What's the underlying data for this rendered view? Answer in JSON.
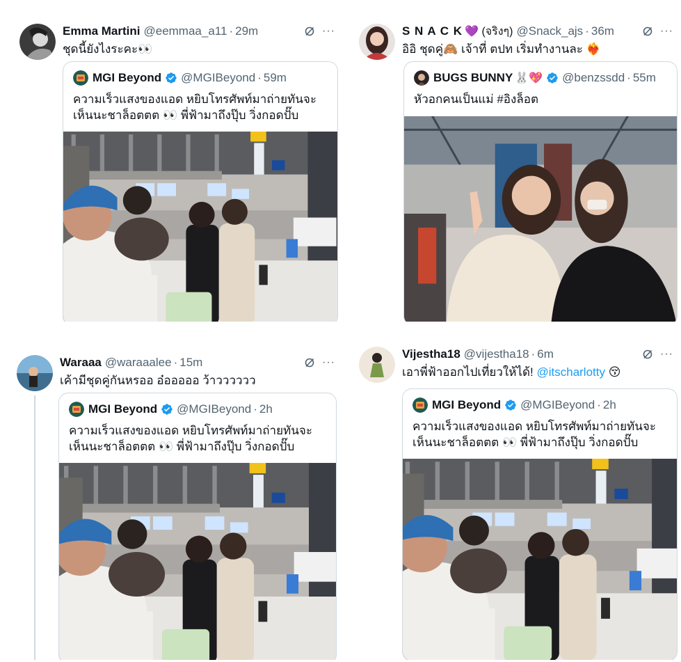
{
  "tweets": [
    {
      "author": "Emma Martini",
      "name_emoji": "",
      "handle": "@eemmaa_a11",
      "time": "29m",
      "text": "ชุดนี้ยังไงระคะ👀",
      "mention": "",
      "text_emoji": "",
      "quote": {
        "author": "MGI Beyond",
        "name_emoji": "",
        "verified": true,
        "handle": "@MGIBeyond",
        "time": "59m",
        "line1": "ความเร็วแสงของแอด หยิบโทรศัพท์มาถ่ายทันจะ",
        "line2": "เห็นนะชาล็อตตต 👀  พี่ฟ้ามาถึงปุ๊บ วิ่งกอดปั๊บ"
      }
    },
    {
      "author": "S N A C K",
      "name_emoji": "💜 (จริงๆ)",
      "handle": "@Snack_ajs",
      "time": "36m",
      "text": "อิอิ ชุดคู่🙈 เจ้าที่ ตปท เริ่มทำงานละ ❤️‍🔥",
      "mention": "",
      "text_emoji": "",
      "quote": {
        "author": "BUGS BUNNY",
        "name_emoji": "🐰💖",
        "verified": true,
        "handle": "@benzssdd",
        "time": "55m",
        "line1": "หัวอกคนเป็นแม่ #อิงล็อต",
        "line2": ""
      }
    },
    {
      "author": "Waraaa",
      "name_emoji": "",
      "handle": "@waraaalee",
      "time": "15m",
      "text": "เค้ามีชุดคู่กันหรออ อ๋อออออ ว้าวววววว",
      "mention": "",
      "text_emoji": "",
      "quote": {
        "author": "MGI Beyond",
        "name_emoji": "",
        "verified": true,
        "handle": "@MGIBeyond",
        "time": "2h",
        "line1": "ความเร็วแสงของแอด หยิบโทรศัพท์มาถ่ายทันจะ",
        "line2": "เห็นนะชาล็อตตต 👀  พี่ฟ้ามาถึงปุ๊บ วิ่งกอดปั๊บ"
      }
    },
    {
      "author": "Vijestha18",
      "name_emoji": "",
      "handle": "@vijestha18",
      "time": "6m",
      "text": "เอาพี่ฟ้าออกไปเที่ยวให้ได้! ",
      "mention": "@itscharlotty",
      "text_emoji": " 😚",
      "quote": {
        "author": "MGI Beyond",
        "name_emoji": "",
        "verified": true,
        "handle": "@MGIBeyond",
        "time": "2h",
        "line1": "ความเร็วแสงของแอด หยิบโทรศัพท์มาถ่ายทันจะ",
        "line2": "เห็นนะชาล็อตตต 👀  พี่ฟ้ามาถึงปุ๊บ วิ่งกอดปั๊บ"
      }
    }
  ],
  "ui": {
    "separator_dot": "·",
    "more_glyph": "···",
    "colors": {
      "text": "#0f1419",
      "secondary": "#536471",
      "link": "#1d9bf0",
      "border": "#cfd9de",
      "verified": "#1d9bf0"
    },
    "icons": [
      "grok-icon",
      "more-icon",
      "verified-icon"
    ]
  }
}
